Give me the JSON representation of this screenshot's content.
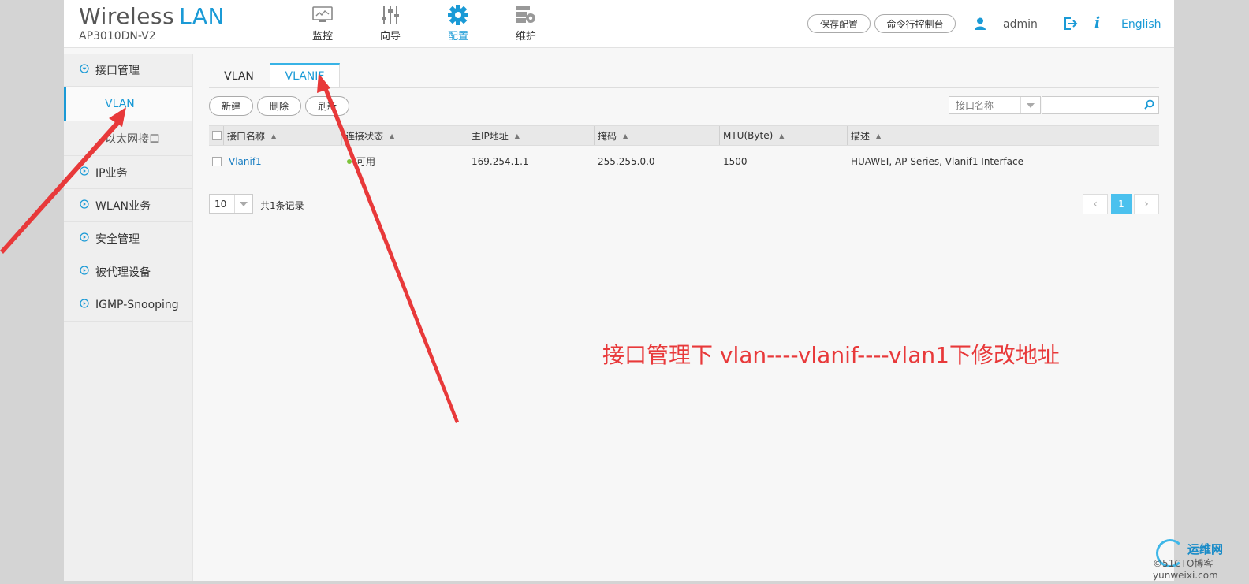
{
  "header": {
    "brand_word1": "Wireless",
    "brand_word2": "LAN",
    "model": "AP3010DN-V2",
    "nav": [
      {
        "label": "监控",
        "icon": "monitor-icon"
      },
      {
        "label": "向导",
        "icon": "sliders-icon"
      },
      {
        "label": "配置",
        "icon": "gear-icon"
      },
      {
        "label": "维护",
        "icon": "server-gear-icon"
      }
    ],
    "active_nav": "配置",
    "save_config": "保存配置",
    "cli_console": "命令行控制台",
    "username": "admin",
    "info": "i",
    "language": "English"
  },
  "sidebar": {
    "groups": [
      {
        "label": "接口管理"
      },
      {
        "label": "IP业务"
      },
      {
        "label": "WLAN业务"
      },
      {
        "label": "安全管理"
      },
      {
        "label": "被代理设备"
      },
      {
        "label": "IGMP-Snooping"
      }
    ],
    "sub_items": [
      {
        "label": "VLAN",
        "active": true
      },
      {
        "label": "以太网接口",
        "active": false
      }
    ]
  },
  "tabs": [
    {
      "label": "VLAN",
      "active": false
    },
    {
      "label": "VLANIF",
      "active": true
    }
  ],
  "toolbar": {
    "new": "新建",
    "delete": "删除",
    "refresh": "刷新",
    "search_field": "接口名称",
    "search_value": ""
  },
  "table": {
    "columns": [
      "接口名称",
      "连接状态",
      "主IP地址",
      "掩码",
      "MTU(Byte)",
      "描述"
    ],
    "rows": [
      {
        "name": "Vlanif1",
        "status": "可用",
        "ip": "169.254.1.1",
        "mask": "255.255.0.0",
        "mtu": "1500",
        "desc": "HUAWEI, AP Series, Vlanif1 Interface"
      }
    ]
  },
  "pager": {
    "page_size": "10",
    "total": "共1条记录",
    "current_page": "1",
    "prev": "‹",
    "next": "›"
  },
  "annotation": "接口管理下  vlan----vlanif----vlan1下修改地址",
  "watermark": {
    "cn": "运维网",
    "site": "©51CTO博客 yunweixi.com"
  },
  "colors": {
    "accent": "#1a9ad6",
    "annotation_red": "#e8393a",
    "status_ok": "#7dc33a",
    "page_active": "#4bc1ee"
  }
}
